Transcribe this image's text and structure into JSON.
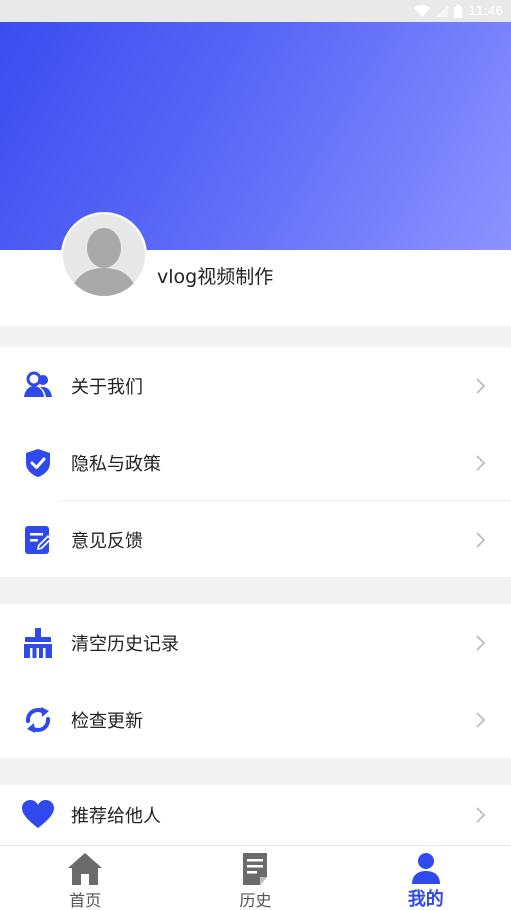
{
  "status_bar": {
    "time": "11:46"
  },
  "profile": {
    "username": "vlog视频制作"
  },
  "menu_groups": [
    {
      "items": [
        {
          "label": "关于我们",
          "icon": "users-icon"
        },
        {
          "label": "隐私与政策",
          "icon": "shield-check-icon"
        },
        {
          "label": "意见反馈",
          "icon": "feedback-edit-icon"
        }
      ]
    },
    {
      "items": [
        {
          "label": "清空历史记录",
          "icon": "broom-icon"
        },
        {
          "label": "检查更新",
          "icon": "refresh-icon"
        }
      ]
    },
    {
      "items": [
        {
          "label": "推荐给他人",
          "icon": "heart-icon"
        }
      ]
    }
  ],
  "tabbar": {
    "tabs": [
      {
        "label": "首页",
        "icon": "home-icon",
        "active": false
      },
      {
        "label": "历史",
        "icon": "history-doc-icon",
        "active": false
      },
      {
        "label": "我的",
        "icon": "user-icon",
        "active": true
      }
    ]
  },
  "colors": {
    "accent": "#2f49ec",
    "header_start": "#3c4cf0",
    "header_end": "#8c93ff",
    "icon_gray": "#6b6b6b"
  }
}
